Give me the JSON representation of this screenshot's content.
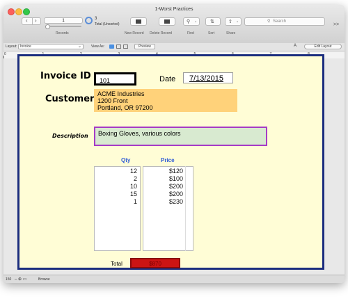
{
  "window": {
    "title": "1-Worst Practices"
  },
  "toolbar": {
    "record_number": "1",
    "record_count": "3",
    "record_total_label": "Total (Unsorted)",
    "records_label": "Records",
    "new_record_label": "New Record",
    "delete_record_label": "Delete Record",
    "find_label": "Find",
    "sort_label": "Sort",
    "share_label": "Share",
    "search_placeholder": "Search",
    "overflow": ">>"
  },
  "layoutbar": {
    "layout_label": "Layout:",
    "layout_value": "Invoice",
    "view_as_label": "View As:",
    "preview_label": "Preview",
    "font_size_icon_label": "A",
    "edit_layout_label": "Edit Layout"
  },
  "ruler": {
    "ticks": [
      "0",
      "1",
      "2",
      "3",
      "4",
      "5",
      "6",
      "7",
      "8"
    ]
  },
  "form": {
    "invoice_id_label": "Invoice ID",
    "invoice_id_value": "101",
    "date_label": "Date",
    "date_value": "7/13/2015",
    "customer_label": "Customer",
    "customer_line1": "ACME Industries",
    "customer_line2": "1200 Front",
    "customer_line3": "Portland, OR 97200",
    "description_label": "Description",
    "description_value": "Boxing Gloves, various colors",
    "qty_header": "Qty",
    "price_header": "Price",
    "rows": [
      {
        "qty": "12",
        "price": "$120"
      },
      {
        "qty": "2",
        "price": "$100"
      },
      {
        "qty": "10",
        "price": "$200"
      },
      {
        "qty": "15",
        "price": "$200"
      },
      {
        "qty": "1",
        "price": "$230"
      }
    ],
    "total_label": "Total",
    "total_value": "$870"
  },
  "statusbar": {
    "zoom": "150",
    "mode": "Browse"
  },
  "colors": {
    "layout_bg": "#fffdd6",
    "layout_border": "#1b2d7e",
    "customer_bg": "#ffd27a",
    "description_bg": "#d8ead0",
    "description_border": "#a63bc6",
    "header_blue": "#2f5bd6",
    "total_bg": "#cc1414"
  }
}
